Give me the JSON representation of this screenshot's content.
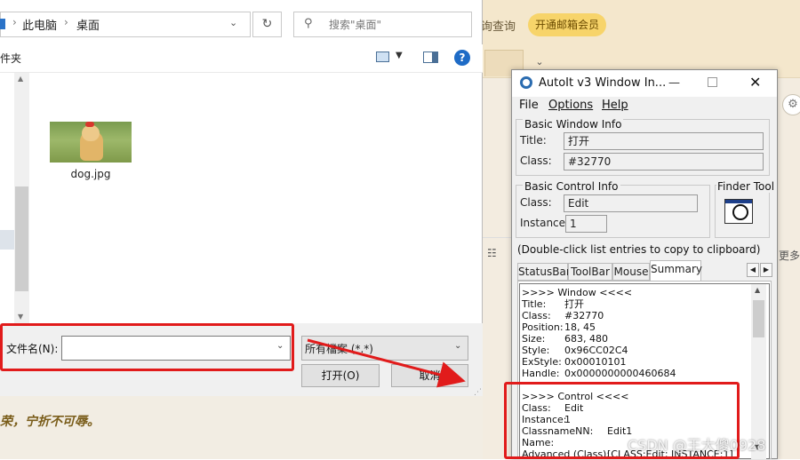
{
  "background": {
    "query_label": "询查询",
    "vip_button": "开通邮箱会员",
    "list_icon_label": "☷",
    "more_label": "更多"
  },
  "dialog": {
    "breadcrumb": {
      "sep1": "›",
      "this_pc": "此电脑",
      "sep2": "›",
      "desktop": "桌面"
    },
    "refresh_icon": "refresh-icon",
    "search_placeholder": "搜索\"桌面\"",
    "folder_label": "件夹",
    "files": [
      {
        "name": "dog.jpg"
      }
    ],
    "filename_label": "文件名(N):",
    "filename_value": "",
    "filetype_value": "所有檔案 (*.*)",
    "open_button": "打开(O)",
    "cancel_button": "取消",
    "below_text": "荣，宁折不可辱。"
  },
  "autoit": {
    "title": "AutoIt v3 Window In...",
    "menu": {
      "file": "File",
      "options": "Options",
      "help": "Help"
    },
    "basic_window": {
      "group_label": "Basic Window Info",
      "title_label": "Title:",
      "title_value": "打开",
      "class_label": "Class:",
      "class_value": "#32770"
    },
    "basic_control": {
      "group_label": "Basic Control Info",
      "class_label": "Class:",
      "class_value": "Edit",
      "instance_label": "Instance:",
      "instance_value": "1"
    },
    "finder_label": "Finder Tool",
    "hint": "(Double-click list entries to copy to clipboard)",
    "tabs": [
      "StatusBar",
      "ToolBar",
      "Mouse",
      "Summary"
    ],
    "summary": {
      "window_header": ">>>> Window <<<<",
      "window_lines": [
        {
          "k": "Title:",
          "v": "打开"
        },
        {
          "k": "Class:",
          "v": "#32770"
        },
        {
          "k": "Position:",
          "v": "18, 45"
        },
        {
          "k": "Size:",
          "v": "683, 480"
        },
        {
          "k": "Style:",
          "v": "0x96CC02C4"
        },
        {
          "k": "ExStyle:",
          "v": "0x00010101"
        },
        {
          "k": "Handle:",
          "v": "0x0000000000460684"
        }
      ],
      "control_header": ">>>> Control <<<<",
      "control_lines": [
        {
          "k": "Class:",
          "v": "Edit"
        },
        {
          "k": "Instance:",
          "v": "1"
        },
        {
          "k": "ClassnameNN:",
          "v": "Edit1"
        },
        {
          "k": "Name:",
          "v": ""
        },
        {
          "k": "Advanced (Class):",
          "v": "[CLASS:Edit; INSTANCE:1]"
        }
      ]
    }
  },
  "watermark": "CSDN @王大傻0928",
  "colors": {
    "annotation_red": "#e11b1b",
    "vip_yellow": "#f7d46a",
    "help_blue": "#1e6bc6"
  }
}
